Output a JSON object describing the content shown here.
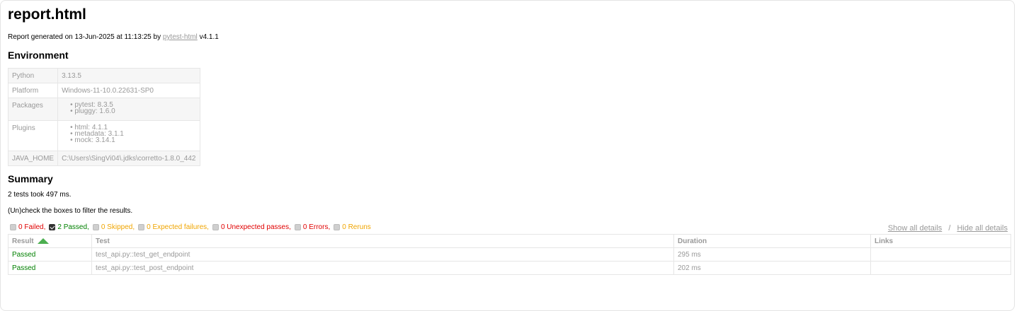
{
  "title": "report.html",
  "generated": {
    "prefix": "Report generated on 13-Jun-2025 at 11:13:25 by",
    "link": "pytest-html",
    "version": "v4.1.1"
  },
  "environment": {
    "heading": "Environment",
    "python": {
      "key": "Python",
      "value": "3.13.5"
    },
    "platform": {
      "key": "Platform",
      "value": "Windows-11-10.0.22631-SP0"
    },
    "packages": {
      "key": "Packages",
      "items": [
        "pytest: 8.3.5",
        "pluggy: 1.6.0"
      ]
    },
    "plugins": {
      "key": "Plugins",
      "items": [
        "html: 4.1.1",
        "metadata: 3.1.1",
        "mock: 3.14.1"
      ]
    },
    "java_home": {
      "key": "JAVA_HOME",
      "value": "C:\\Users\\SingVi04\\.jdks\\corretto-1.8.0_442"
    }
  },
  "summary": {
    "heading": "Summary",
    "took": "2 tests took 497 ms.",
    "instruction": "(Un)check the boxes to filter the results."
  },
  "filters": {
    "failed": "0 Failed,",
    "passed": "2 Passed,",
    "skipped": "0 Skipped,",
    "xfailed": "0 Expected failures,",
    "xpassed": "0 Unexpected passes,",
    "errors": "0 Errors,",
    "reruns": "0 Reruns"
  },
  "details_links": {
    "show": "Show all details",
    "separator": "/",
    "hide": "Hide all details"
  },
  "results": {
    "headers": {
      "result": "Result",
      "test": "Test",
      "duration": "Duration",
      "links": "Links"
    },
    "rows": [
      {
        "result": "Passed",
        "test": "test_api.py::test_get_endpoint",
        "duration": "295 ms",
        "links": ""
      },
      {
        "result": "Passed",
        "test": "test_api.py::test_post_endpoint",
        "duration": "202 ms",
        "links": ""
      }
    ]
  },
  "colors": {
    "failed": "#e00000",
    "passed": "#008000",
    "skipped": "#f0a500",
    "sort_arrow": "#4caf50"
  }
}
